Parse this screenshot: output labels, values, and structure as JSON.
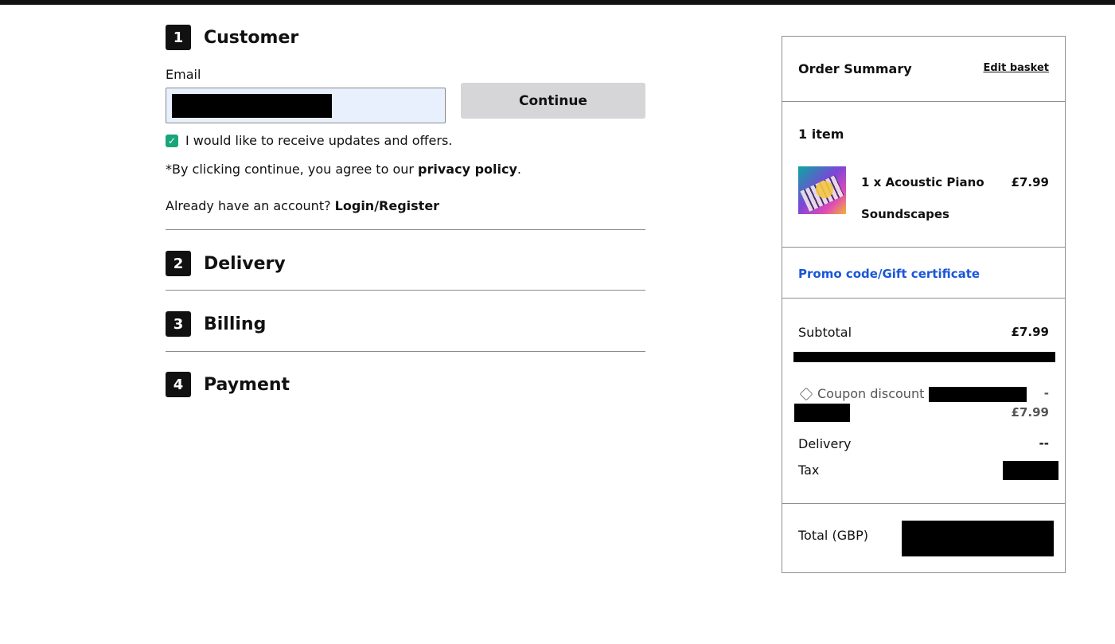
{
  "checkout": {
    "steps": [
      {
        "number": "1",
        "title": "Customer"
      },
      {
        "number": "2",
        "title": "Delivery"
      },
      {
        "number": "3",
        "title": "Billing"
      },
      {
        "number": "4",
        "title": "Payment"
      }
    ],
    "customer": {
      "email_label": "Email",
      "email_value": "",
      "continue_label": "Continue",
      "optin_label": "I would like to receive updates and offers.",
      "optin_checked": true,
      "consent_prefix": "*By clicking continue, you agree to our ",
      "consent_link": "privacy policy",
      "consent_suffix": ".",
      "account_prefix": "Already have an account? ",
      "account_link": "Login/Register"
    }
  },
  "summary": {
    "title": "Order Summary",
    "edit_basket": "Edit basket",
    "items_count": "1 item",
    "item": {
      "name": "1 x Acoustic Piano Soundscapes",
      "price": "£7.99"
    },
    "promo_link": "Promo code/Gift certificate",
    "subtotal_label": "Subtotal",
    "subtotal_value": "£7.99",
    "coupon_label": "Coupon discount (",
    "coupon_value_sign": "-",
    "coupon_value": "£7.99",
    "delivery_label": "Delivery",
    "delivery_value": "--",
    "tax_label": "Tax",
    "total_label": "Total (GBP)"
  },
  "colors": {
    "accent_link": "#1a56d8",
    "checkbox": "#17a57a",
    "button_bg": "#d6d6d9"
  }
}
